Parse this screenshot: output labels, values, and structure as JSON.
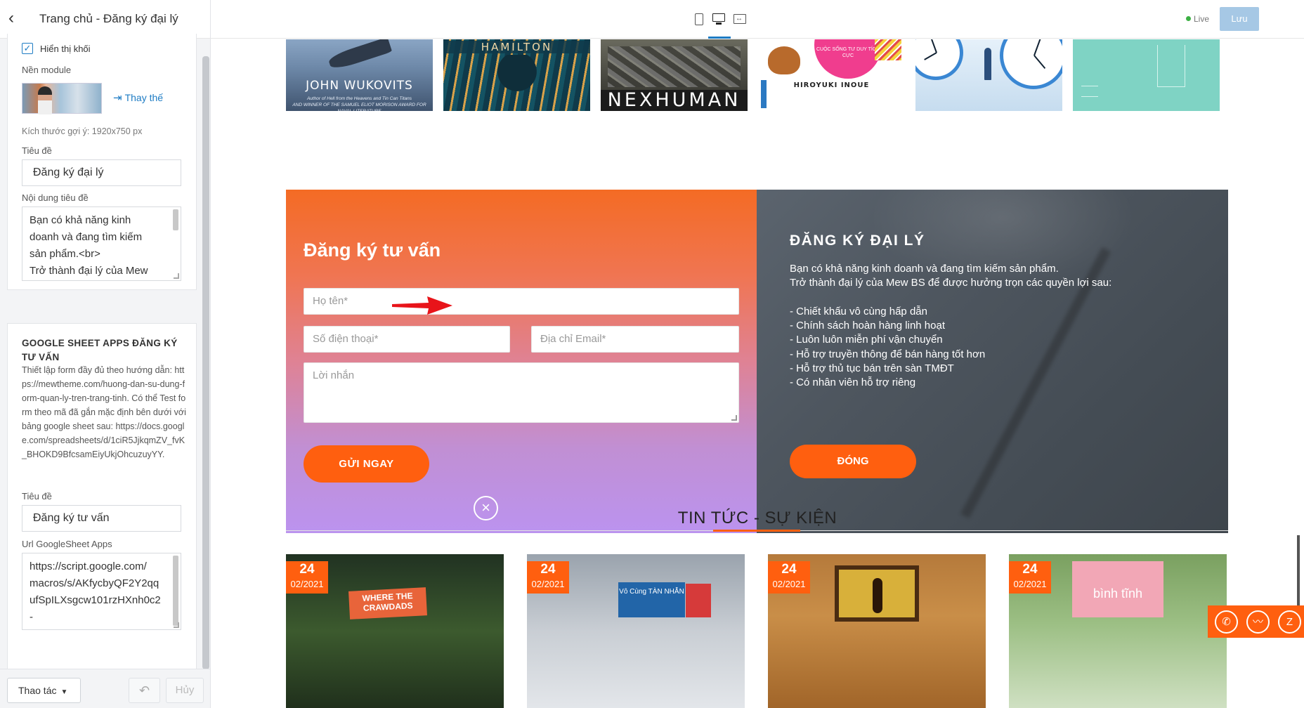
{
  "sidebar": {
    "title": "Trang chủ - Đăng ký đại lý",
    "show_block_label": "Hiển thị khối",
    "bg_module_label": "Nền module",
    "replace_label": "Thay thế",
    "size_hint": "Kích thước gợi ý: 1920x750 px",
    "title_label": "Tiêu đề",
    "title_value": "Đăng ký đại lý",
    "content_label": "Nội dung tiêu đề",
    "content_lines": [
      "Bạn có khả năng kinh",
      "doanh và đang tìm kiếm",
      "sản phẩm.<br>",
      "Trở thành đại lý của Mew"
    ],
    "section2_title": "GOOGLE SHEET APPS ĐĂNG KÝ TƯ VẤN",
    "section2_desc": "Thiết lập form đầy đủ theo hướng dẫn: https://mewtheme.com/huong-dan-su-dung-form-quan-ly-tren-trang-tinh. Có thể Test form theo mã đã gắn mặc định bên dưới với bảng google sheet sau: https://docs.google.com/spreadsheets/d/1ciR5JjkqmZV_fvK_BHOKD9BfcsamEiyUkjOhcuzuyYY.",
    "title2_label": "Tiêu đề",
    "title2_value": "Đăng ký tư vấn",
    "url_label": "Url GoogleSheet Apps",
    "url_lines": [
      "https://script.google.com/",
      "macros/s/AKfycbyQF2Y2qq",
      "ufSpILXsgcw101rzHXnh0c2",
      "-"
    ],
    "actions_label": "Thao tác",
    "cancel_label": "Hủy",
    "back_icon": "chevron-left-icon",
    "check_icon": "checkmark-icon",
    "undo_icon": "undo-icon"
  },
  "topbar": {
    "devices": [
      "tablet-icon",
      "desktop-icon",
      "fluid-width-icon"
    ],
    "active_device": "desktop",
    "live_label": "Live",
    "save_label": "Lưu",
    "accent_color": "#1e7cc4"
  },
  "books": [
    {
      "title": "JOHN WUKOVITS",
      "subtitle": "Author of Hell from the Heavens and Tin Can Titans",
      "line2": "AND WINNER OF THE SAMUEL ELIOT MORISON AWARD FOR NAVAL LITERATURE"
    },
    {
      "title": "HAMILTON"
    },
    {
      "title": "NEXHUMAN"
    },
    {
      "title": "HIROYUKI INOUE",
      "badge": "CUỘC SỐNG TƯ DUY TÍCH CỰC"
    },
    {
      "title": ""
    },
    {
      "title": ""
    }
  ],
  "register_form": {
    "heading": "Đăng ký tư vấn",
    "name_placeholder": "Họ tên*",
    "phone_placeholder": "Số điện thoại*",
    "email_placeholder": "Địa chỉ Email*",
    "message_placeholder": "Lời nhắn",
    "submit_label": "GỬI NGAY",
    "gradient_top": "#f46b24",
    "gradient_bottom": "#bb93ef"
  },
  "agency": {
    "heading": "ĐĂNG KÝ ĐẠI LÝ",
    "lines": [
      "Bạn có khả năng kinh doanh và đang tìm kiếm sản phẩm.",
      "Trở thành đại lý của Mew BS để được hưởng trọn các quyền lợi sau:",
      "",
      "- Chiết khấu vô cùng hấp dẫn",
      "- Chính sách hoàn hàng linh hoạt",
      "- Luôn luôn miễn phí vận chuyển",
      "- Hỗ trợ truyền thông để bán hàng tốt hơn",
      "- Hỗ trợ thủ tục bán trên sàn TMĐT",
      "- Có nhân viên hỗ trợ riêng"
    ],
    "close_label": "ĐÓNG",
    "button_color": "#ff5f0f"
  },
  "news": {
    "title": "TIN TỨC - SỰ KIỆN",
    "items": [
      {
        "day": "24",
        "month": "02/2021",
        "cover_text": "WHERE THE CRAWDADS"
      },
      {
        "day": "24",
        "month": "02/2021",
        "cover_text": "Vô Cùng TÀN NHẪN"
      },
      {
        "day": "24",
        "month": "02/2021",
        "cover_text": ""
      },
      {
        "day": "24",
        "month": "02/2021",
        "cover_text": "bình tĩnh"
      }
    ]
  },
  "float_bar": {
    "icons": [
      "phone-icon",
      "messenger-icon",
      "zalo-icon"
    ],
    "color": "#ff5f0f"
  }
}
